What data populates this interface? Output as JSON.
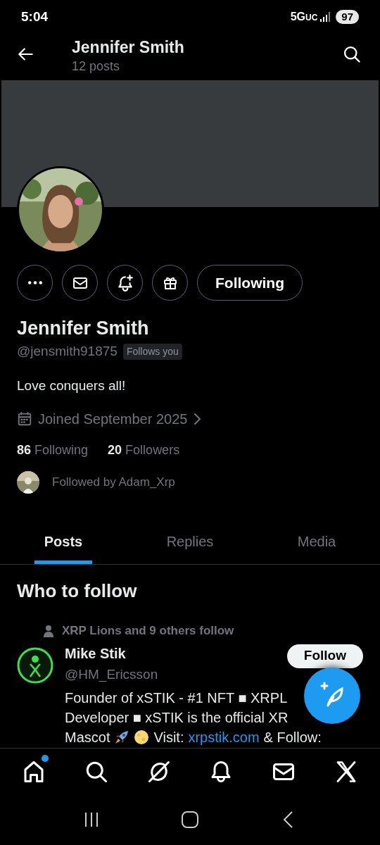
{
  "status_bar": {
    "time": "5:04",
    "network": "5G",
    "network_suffix": "UC",
    "battery": "97"
  },
  "header": {
    "title": "Jennifer Smith",
    "subtitle": "12 posts"
  },
  "follow_button": {
    "label": "Following"
  },
  "profile": {
    "name": "Jennifer Smith",
    "handle": "@jensmith91875",
    "follows_you": "Follows you",
    "bio": "Love conquers all!",
    "joined": "Joined September 2025",
    "stats": [
      {
        "count": "86",
        "label": "Following"
      },
      {
        "count": "20",
        "label": "Followers"
      }
    ],
    "followed_by": "Followed by Adam_Xrp"
  },
  "tabs": [
    {
      "label": "Posts",
      "selected": true
    },
    {
      "label": "Replies",
      "selected": false
    },
    {
      "label": "Media",
      "selected": false
    }
  ],
  "who_to_follow": {
    "title": "Who to follow",
    "suggestions": [
      {
        "context": "XRP Lions and 9 others follow",
        "name": "Mike Stik",
        "handle": "@HM_Ericsson",
        "button": "Follow",
        "bio_lines": [
          [
            {
              "kind": "text",
              "text": "Founder of xSTIK - #1 NFT ■ XRPL"
            }
          ],
          [
            {
              "kind": "text",
              "text": "Developer ■ xSTIK is the official XR"
            }
          ],
          [
            {
              "kind": "text",
              "text": "Mascot"
            },
            {
              "kind": "rocket"
            },
            {
              "kind": "moon"
            },
            {
              "kind": "text",
              "text": "Visit:"
            },
            {
              "kind": "link",
              "text": "xrpstik.com"
            },
            {
              "kind": "text",
              "text": "& Follow:"
            }
          ]
        ]
      }
    ]
  },
  "bottom_nav": [
    {
      "badge": true
    },
    {
      "badge": false
    },
    {
      "badge": false
    },
    {
      "badge": false
    },
    {
      "badge": false
    },
    {
      "badge": false
    }
  ]
}
